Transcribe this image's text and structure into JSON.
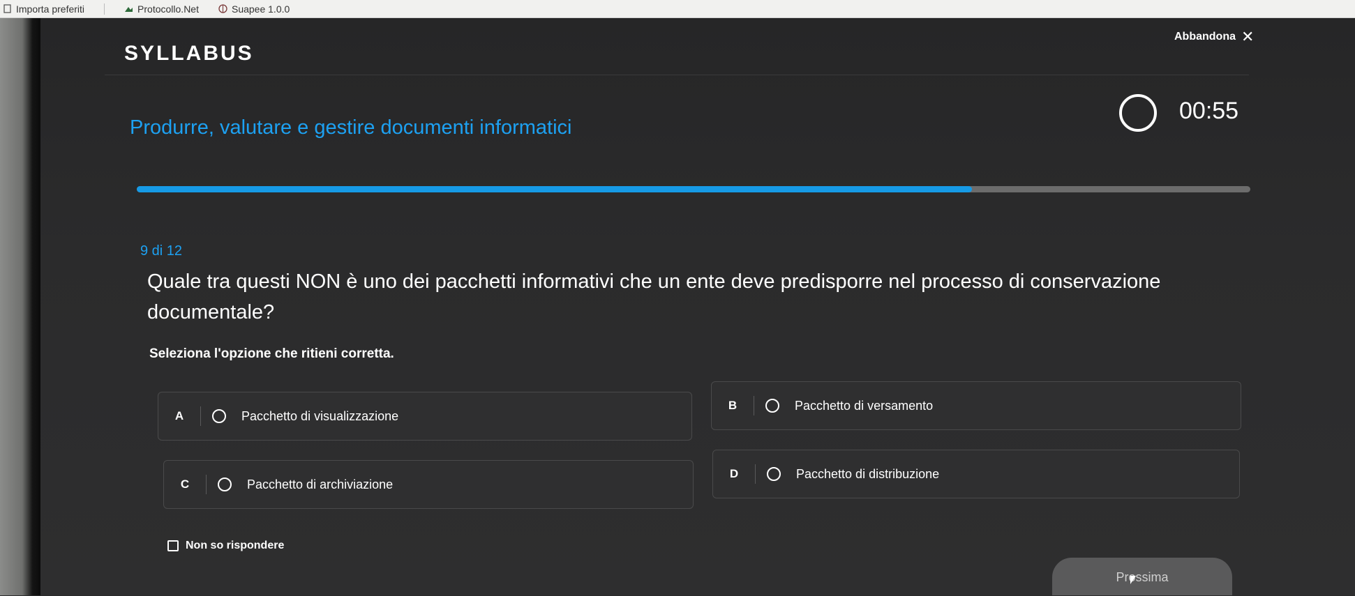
{
  "bookmarks": [
    {
      "label": "Importa preferiti",
      "icon": "bookmark-icon"
    },
    {
      "label": "Protocollo.Net",
      "icon": "site-icon"
    },
    {
      "label": "Suapee 1.0.0",
      "icon": "globe-icon"
    }
  ],
  "app": {
    "logo": "SYLLABUS",
    "quit_label": "Abbandona",
    "quit_icon": "close-icon"
  },
  "course": {
    "title": "Produrre, valutare e gestire documenti informatici"
  },
  "timer": {
    "value": "00:55"
  },
  "progress": {
    "fraction": 0.75
  },
  "quiz": {
    "counter": "9 di 12",
    "question": "Quale tra questi NON è uno dei pacchetti informativi che un ente deve predisporre nel processo di conservazione documentale?",
    "instruction": "Seleziona l'opzione che ritieni corretta.",
    "options": [
      {
        "letter": "A",
        "label": "Pacchetto di visualizzazione"
      },
      {
        "letter": "B",
        "label": "Pacchetto di versamento"
      },
      {
        "letter": "C",
        "label": "Pacchetto di archiviazione"
      },
      {
        "letter": "D",
        "label": "Pacchetto di distribuzione"
      }
    ],
    "no_answer_label": "Non so rispondere",
    "next_label": "Prossima"
  },
  "colors": {
    "accent": "#1da1f2",
    "progress_fill": "#169ae6",
    "progress_track": "#6c6c6c",
    "background": "#2a2a2b"
  }
}
